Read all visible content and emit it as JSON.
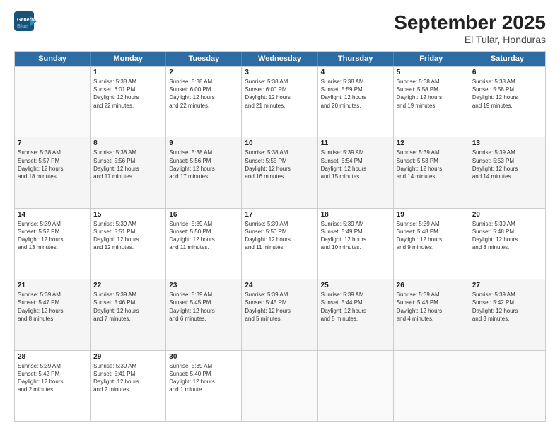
{
  "header": {
    "logo_line1": "General",
    "logo_line2": "Blue",
    "month": "September 2025",
    "location": "El Tular, Honduras"
  },
  "days": [
    "Sunday",
    "Monday",
    "Tuesday",
    "Wednesday",
    "Thursday",
    "Friday",
    "Saturday"
  ],
  "weeks": [
    [
      {
        "day": "",
        "info": ""
      },
      {
        "day": "1",
        "info": "Sunrise: 5:38 AM\nSunset: 6:01 PM\nDaylight: 12 hours\nand 22 minutes."
      },
      {
        "day": "2",
        "info": "Sunrise: 5:38 AM\nSunset: 6:00 PM\nDaylight: 12 hours\nand 22 minutes."
      },
      {
        "day": "3",
        "info": "Sunrise: 5:38 AM\nSunset: 6:00 PM\nDaylight: 12 hours\nand 21 minutes."
      },
      {
        "day": "4",
        "info": "Sunrise: 5:38 AM\nSunset: 5:59 PM\nDaylight: 12 hours\nand 20 minutes."
      },
      {
        "day": "5",
        "info": "Sunrise: 5:38 AM\nSunset: 5:58 PM\nDaylight: 12 hours\nand 19 minutes."
      },
      {
        "day": "6",
        "info": "Sunrise: 5:38 AM\nSunset: 5:58 PM\nDaylight: 12 hours\nand 19 minutes."
      }
    ],
    [
      {
        "day": "7",
        "info": "Sunrise: 5:38 AM\nSunset: 5:57 PM\nDaylight: 12 hours\nand 18 minutes."
      },
      {
        "day": "8",
        "info": "Sunrise: 5:38 AM\nSunset: 5:56 PM\nDaylight: 12 hours\nand 17 minutes."
      },
      {
        "day": "9",
        "info": "Sunrise: 5:38 AM\nSunset: 5:56 PM\nDaylight: 12 hours\nand 17 minutes."
      },
      {
        "day": "10",
        "info": "Sunrise: 5:38 AM\nSunset: 5:55 PM\nDaylight: 12 hours\nand 16 minutes."
      },
      {
        "day": "11",
        "info": "Sunrise: 5:39 AM\nSunset: 5:54 PM\nDaylight: 12 hours\nand 15 minutes."
      },
      {
        "day": "12",
        "info": "Sunrise: 5:39 AM\nSunset: 5:53 PM\nDaylight: 12 hours\nand 14 minutes."
      },
      {
        "day": "13",
        "info": "Sunrise: 5:39 AM\nSunset: 5:53 PM\nDaylight: 12 hours\nand 14 minutes."
      }
    ],
    [
      {
        "day": "14",
        "info": "Sunrise: 5:39 AM\nSunset: 5:52 PM\nDaylight: 12 hours\nand 13 minutes."
      },
      {
        "day": "15",
        "info": "Sunrise: 5:39 AM\nSunset: 5:51 PM\nDaylight: 12 hours\nand 12 minutes."
      },
      {
        "day": "16",
        "info": "Sunrise: 5:39 AM\nSunset: 5:50 PM\nDaylight: 12 hours\nand 11 minutes."
      },
      {
        "day": "17",
        "info": "Sunrise: 5:39 AM\nSunset: 5:50 PM\nDaylight: 12 hours\nand 11 minutes."
      },
      {
        "day": "18",
        "info": "Sunrise: 5:39 AM\nSunset: 5:49 PM\nDaylight: 12 hours\nand 10 minutes."
      },
      {
        "day": "19",
        "info": "Sunrise: 5:39 AM\nSunset: 5:48 PM\nDaylight: 12 hours\nand 9 minutes."
      },
      {
        "day": "20",
        "info": "Sunrise: 5:39 AM\nSunset: 5:48 PM\nDaylight: 12 hours\nand 8 minutes."
      }
    ],
    [
      {
        "day": "21",
        "info": "Sunrise: 5:39 AM\nSunset: 5:47 PM\nDaylight: 12 hours\nand 8 minutes."
      },
      {
        "day": "22",
        "info": "Sunrise: 5:39 AM\nSunset: 5:46 PM\nDaylight: 12 hours\nand 7 minutes."
      },
      {
        "day": "23",
        "info": "Sunrise: 5:39 AM\nSunset: 5:45 PM\nDaylight: 12 hours\nand 6 minutes."
      },
      {
        "day": "24",
        "info": "Sunrise: 5:39 AM\nSunset: 5:45 PM\nDaylight: 12 hours\nand 5 minutes."
      },
      {
        "day": "25",
        "info": "Sunrise: 5:39 AM\nSunset: 5:44 PM\nDaylight: 12 hours\nand 5 minutes."
      },
      {
        "day": "26",
        "info": "Sunrise: 5:39 AM\nSunset: 5:43 PM\nDaylight: 12 hours\nand 4 minutes."
      },
      {
        "day": "27",
        "info": "Sunrise: 5:39 AM\nSunset: 5:42 PM\nDaylight: 12 hours\nand 3 minutes."
      }
    ],
    [
      {
        "day": "28",
        "info": "Sunrise: 5:39 AM\nSunset: 5:42 PM\nDaylight: 12 hours\nand 2 minutes."
      },
      {
        "day": "29",
        "info": "Sunrise: 5:39 AM\nSunset: 5:41 PM\nDaylight: 12 hours\nand 2 minutes."
      },
      {
        "day": "30",
        "info": "Sunrise: 5:39 AM\nSunset: 5:40 PM\nDaylight: 12 hours\nand 1 minute."
      },
      {
        "day": "",
        "info": ""
      },
      {
        "day": "",
        "info": ""
      },
      {
        "day": "",
        "info": ""
      },
      {
        "day": "",
        "info": ""
      }
    ]
  ]
}
